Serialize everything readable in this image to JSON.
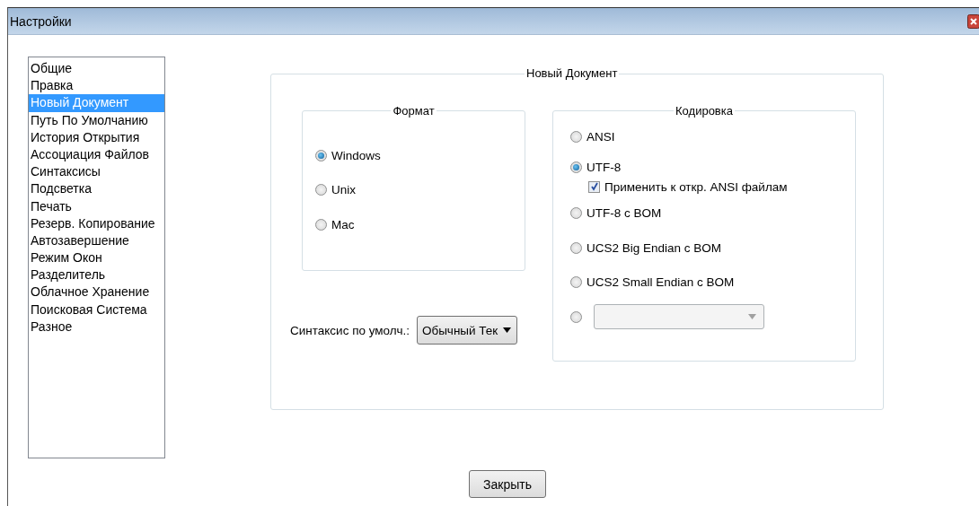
{
  "window": {
    "title": "Настройки"
  },
  "sidebar": {
    "items": [
      {
        "label": "Общие",
        "selected": false
      },
      {
        "label": "Правка",
        "selected": false
      },
      {
        "label": "Новый Документ",
        "selected": true
      },
      {
        "label": "Путь По Умолчанию",
        "selected": false
      },
      {
        "label": "История Открытия",
        "selected": false
      },
      {
        "label": "Ассоциация Файлов",
        "selected": false
      },
      {
        "label": "Синтаксисы",
        "selected": false
      },
      {
        "label": "Подсветка",
        "selected": false
      },
      {
        "label": "Печать",
        "selected": false
      },
      {
        "label": "Резерв. Копирование",
        "selected": false
      },
      {
        "label": "Автозавершение",
        "selected": false
      },
      {
        "label": "Режим Окон",
        "selected": false
      },
      {
        "label": "Разделитель",
        "selected": false
      },
      {
        "label": "Облачное Хранение",
        "selected": false
      },
      {
        "label": "Поисковая Система",
        "selected": false
      },
      {
        "label": "Разное",
        "selected": false
      }
    ]
  },
  "panel": {
    "title": "Новый Документ",
    "format": {
      "title": "Формат",
      "options": [
        {
          "label": "Windows",
          "selected": true
        },
        {
          "label": "Unix",
          "selected": false
        },
        {
          "label": "Mac",
          "selected": false
        }
      ]
    },
    "syntax": {
      "label": "Синтаксис по умолч.:",
      "value": "Обычный Тек"
    },
    "encoding": {
      "title": "Кодировка",
      "options": [
        {
          "kind": "radio",
          "label": "ANSI",
          "selected": false
        },
        {
          "kind": "radio",
          "label": "UTF-8",
          "selected": true
        },
        {
          "kind": "checkbox",
          "label": "Применить к откр. ANSI файлам",
          "checked": true
        },
        {
          "kind": "radio",
          "label": "UTF-8 с BOM",
          "selected": false
        },
        {
          "kind": "radio",
          "label": "UCS2 Big Endian с BOM",
          "selected": false
        },
        {
          "kind": "radio",
          "label": "UCS2 Small Endian с BOM",
          "selected": false
        },
        {
          "kind": "radio-dropdown",
          "selected": false,
          "disabled": true
        }
      ]
    }
  },
  "buttons": [
    {
      "label": "Закрыть"
    }
  ]
}
